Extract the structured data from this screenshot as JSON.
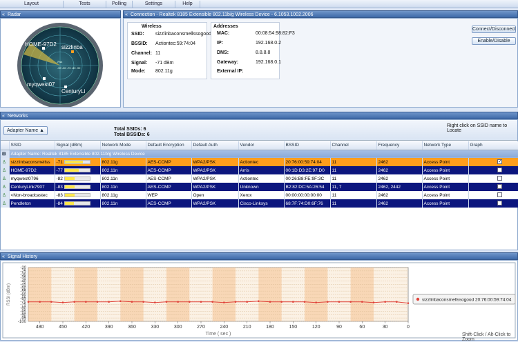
{
  "menu": {
    "tabs": [
      "Layout",
      "Tests",
      "Polling",
      "Settings",
      "Help"
    ]
  },
  "radar": {
    "title": "Radar",
    "labels": [
      "HOME-97D2",
      "sizzlinba",
      "myqwest07",
      "CenturyLi"
    ],
    "scale": "-59 -60 -70 -80 -90",
    "center_label": "-Rss"
  },
  "connection": {
    "title": "Connection - Realtek 8185 Extensible 802.11b/g Wireless Device - 6.1053.1002.2006",
    "wireless_heading": "Wireless",
    "addresses_heading": "Addresses",
    "ssid_label": "SSID:",
    "ssid": "sizzlinbaconsmellssogood",
    "bssid_label": "BSSID:",
    "bssid": "Actiontec:59:74:04",
    "channel_label": "Channel:",
    "channel": "11",
    "signal_label": "Signal:",
    "signal": "-71 dBm",
    "mode_label": "Mode:",
    "mode": "802.11g",
    "mac_label": "MAC:",
    "mac": "00:08:54:98:82:F3",
    "ip_label": "IP:",
    "ip": "192.168.0.2",
    "dns_label": "DNS:",
    "dns": "8.8.8.8",
    "gateway_label": "Gateway:",
    "gateway": "192.168.0.1",
    "external_ip_label": "External IP:",
    "connect_button": "Connect/Disconnect",
    "enable_button": "Enable/Disable"
  },
  "networks": {
    "title": "Networks",
    "group_button": "Adapter Name ▲",
    "total_ssids": "Total SSIDs: 6",
    "total_bssids": "Total BSSIDs: 6",
    "hint": "Right click on SSID name to Locate",
    "columns": [
      "SSID",
      "Signal (dBm)",
      "Network Mode",
      "Default Encryption",
      "Default Auth",
      "Vendor",
      "BSSID",
      "Channel",
      "Frequency",
      "Network Type",
      "Graph"
    ],
    "group_row": "Adapter Name: Realtek 8185 Extensible 802.11b/g Wireless Device",
    "rows": [
      {
        "ssid": "sizzlinbaconsmellss",
        "signal": "-71",
        "level": 0.72,
        "mode": "802.11g",
        "enc": "AES-CCMP",
        "auth": "WPA2/PSK",
        "vendor": "Actiontec",
        "bssid": "20:76:00:59:74:04",
        "channel": "11",
        "freq": "2462",
        "type": "Access Point",
        "graph": true,
        "style": "r0"
      },
      {
        "ssid": "HOME-97D2",
        "signal": "-77",
        "level": 0.55,
        "mode": "802.11n",
        "enc": "AES-CCMP",
        "auth": "WPA2/PSK",
        "vendor": "Arris",
        "bssid": "00:1D:D3:2E:97:D0",
        "channel": "11",
        "freq": "2462",
        "type": "Access Point",
        "graph": false,
        "style": "rb"
      },
      {
        "ssid": "myqwest0796",
        "signal": "-82",
        "level": 0.4,
        "mode": "802.11n",
        "enc": "AES-CCMP",
        "auth": "WPA2/PSK",
        "vendor": "Actiontec",
        "bssid": "00:26:B8:FE:9F:3C",
        "channel": "11",
        "freq": "2462",
        "type": "Access Point",
        "graph": false,
        "style": "rw"
      },
      {
        "ssid": "CenturyLink7907",
        "signal": "-83",
        "level": 0.38,
        "mode": "802.11n",
        "enc": "AES-CCMP",
        "auth": "WPA2/PSK",
        "vendor": "Unknown",
        "bssid": "B2:82:DC:5A:26:54",
        "channel": "11, 7",
        "freq": "2462, 2442",
        "type": "Access Point",
        "graph": false,
        "style": "rb"
      },
      {
        "ssid": "<Non-broadcastec",
        "signal": "-83",
        "level": 0.38,
        "mode": "802.11g",
        "enc": "WEP",
        "auth": "Open",
        "vendor": "Xerox",
        "bssid": "00:00:00:00:00:00",
        "channel": "11",
        "freq": "2462",
        "type": "Access Point",
        "graph": false,
        "style": "rw"
      },
      {
        "ssid": "Pendleton",
        "signal": "-84",
        "level": 0.35,
        "mode": "802.11n",
        "enc": "AES-CCMP",
        "auth": "WPA2/PSK",
        "vendor": "Cisco-Linksys",
        "bssid": "68:7F:74:D0:6F:76",
        "channel": "11",
        "freq": "2462",
        "type": "Access Point",
        "graph": false,
        "style": "rb"
      }
    ]
  },
  "history": {
    "title": "Signal History",
    "ylabel": "RSSI (dBm)",
    "xlabel": "Time ( sec )",
    "legend": "sizzlinbaconsmellssogood 20:76:00:59:74:04",
    "footer": "Shift-Click / Alt-Click to Zoom",
    "colors": {
      "line": "#e0433a",
      "band": "#f6c18f"
    }
  },
  "chart_data": {
    "type": "line",
    "xlabel": "Time ( sec )",
    "ylabel": "RSSI (dBm)",
    "ylim": [
      -100,
      -20
    ],
    "xlim": [
      495,
      0
    ],
    "yticks": [
      -20,
      -25,
      -30,
      -35,
      -40,
      -45,
      -50,
      -55,
      -60,
      -65,
      -70,
      -75,
      -80,
      -85,
      -90,
      -95,
      -100
    ],
    "xticks": [
      480,
      450,
      420,
      390,
      360,
      330,
      300,
      270,
      240,
      210,
      180,
      150,
      120,
      90,
      60,
      30,
      0
    ],
    "series": [
      {
        "name": "sizzlinbaconsmellssogood 20:76:00:59:74:04",
        "x": [
          495,
          480,
          465,
          450,
          435,
          420,
          405,
          390,
          375,
          360,
          345,
          330,
          315,
          300,
          285,
          270,
          255,
          240,
          225,
          210,
          195,
          180,
          165,
          150,
          135,
          120,
          105,
          90,
          75,
          60,
          45,
          30,
          15,
          0
        ],
        "y": [
          -71,
          -71,
          -71,
          -72,
          -71,
          -71,
          -71,
          -71,
          -70,
          -71,
          -71,
          -72,
          -71,
          -71,
          -71,
          -71,
          -71,
          -72,
          -71,
          -71,
          -70,
          -71,
          -71,
          -71,
          -71,
          -72,
          -71,
          -71,
          -71,
          -71,
          -72,
          -71,
          -71,
          -73
        ]
      }
    ]
  }
}
